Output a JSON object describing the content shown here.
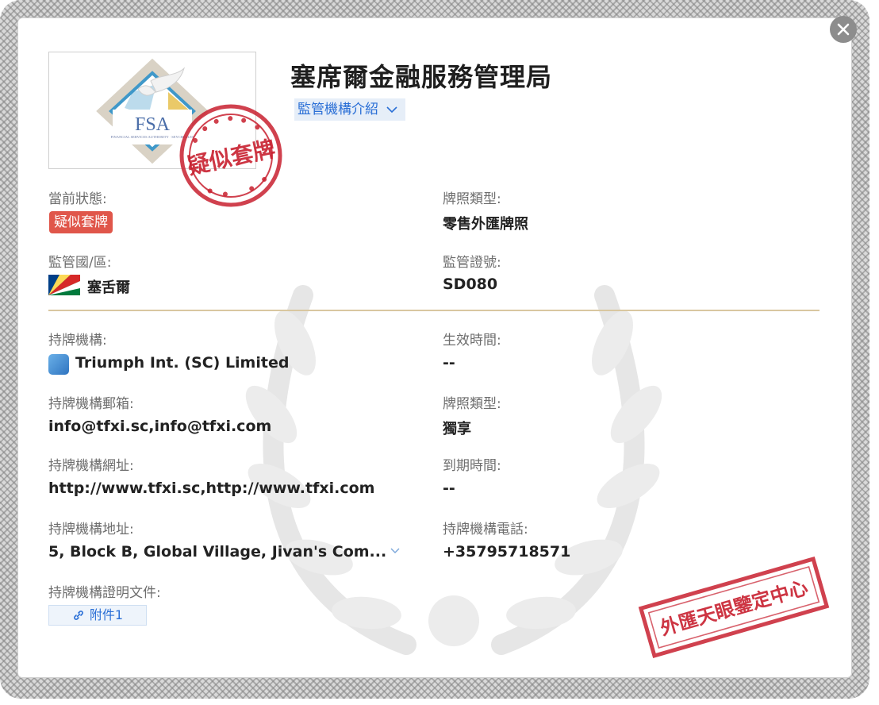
{
  "header": {
    "title": "塞席爾金融服務管理局",
    "intro_label": "監管機構介紹"
  },
  "logo": {
    "text": "FSA",
    "subtext": "FINANCIAL SERVICES AUTHORITY · SEYCHELLES"
  },
  "stamps": {
    "suspected_text": "疑似套牌",
    "center_text": "外匯天眼鑒定中心"
  },
  "fields": {
    "status_label": "當前狀態:",
    "status_value": "疑似套牌",
    "license_type_label": "牌照類型:",
    "license_type_value": "零售外匯牌照",
    "region_label": "監管國/區:",
    "region_value": "塞舌爾",
    "license_no_label": "監管證號:",
    "license_no_value": "SD080",
    "org_label": "持牌機構:",
    "org_value": "Triumph Int. (SC) Limited",
    "effective_label": "生效時間:",
    "effective_value": "--",
    "email_label": "持牌機構郵箱:",
    "email_value": "info@tfxi.sc,info@tfxi.com",
    "license_type2_label": "牌照類型:",
    "license_type2_value": "獨享",
    "website_label": "持牌機構網址:",
    "website_value": "http://www.tfxi.sc,http://www.tfxi.com",
    "expiry_label": "到期時間:",
    "expiry_value": "--",
    "address_label": "持牌機構地址:",
    "address_value": "5, Block B, Global Village, Jivan's Com...",
    "phone_label": "持牌機構電話:",
    "phone_value": "+35795718571",
    "docs_label": "持牌機構證明文件:",
    "attachment_label": "附件1"
  },
  "colors": {
    "accent": "#2a6fd6",
    "badge": "#e0564a",
    "stamp": "#c8202f",
    "divider": "#d9c7a0"
  },
  "icons": [
    "close-icon",
    "chevron-down-icon",
    "link-icon",
    "seychelles-flag-icon",
    "company-icon"
  ]
}
